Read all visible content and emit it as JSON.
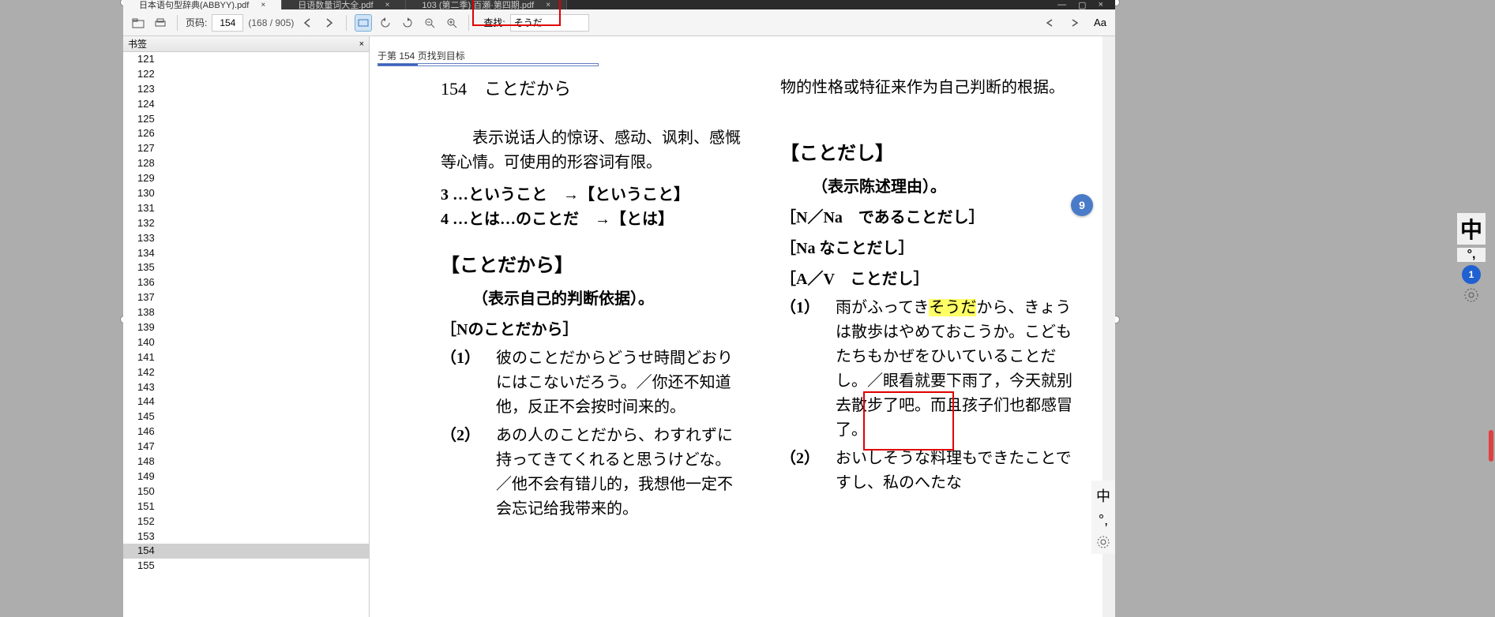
{
  "tabs": [
    {
      "title": "日本语句型辞典(ABBYY).pdf"
    },
    {
      "title": "日语数量词大全.pdf"
    },
    {
      "title": "103 (第二季) 百瀬·第四期.pdf"
    }
  ],
  "toolbar": {
    "page_label": "页码:",
    "page_value": "154",
    "page_count": "(168 / 905)",
    "search_label": "查找:",
    "search_value": "そうだ"
  },
  "sidebar": {
    "title": "书签",
    "items": [
      "121",
      "122",
      "123",
      "124",
      "125",
      "126",
      "127",
      "128",
      "129",
      "130",
      "131",
      "132",
      "133",
      "134",
      "135",
      "136",
      "137",
      "138",
      "139",
      "140",
      "141",
      "142",
      "143",
      "144",
      "145",
      "146",
      "147",
      "148",
      "149",
      "150",
      "151",
      "152",
      "153",
      "154",
      "155"
    ],
    "selected": "154"
  },
  "search_status": "于第 154 页找到目标",
  "page_badge": "9",
  "doc": {
    "heading": "154　ことだから",
    "left": {
      "p1": "　　表示说话人的惊讶、感动、讽刺、感慨等心情。可使用的形容词有限。",
      "l3": "3 …ということ　→【ということ】",
      "l4": "4 …とは…のことだ　→【とは】",
      "title": "【ことだから】",
      "subtitle": "（表示自己的判断依据）。",
      "pattern": "［Nのことだから］",
      "ex1_num": "（1）",
      "ex1": "彼のことだからどうせ時間どおりにはこないだろう。／你还不知道他，反正不会按时间来的。",
      "ex2_num": "（2）",
      "ex2": "あの人のことだから、わすれずに持ってきてくれると思うけどな。／他不会有错儿的，我想他一定不会忘记给我带来的。"
    },
    "right": {
      "p1": "物的性格或特征来作为自己判断的根据。",
      "title": "【ことだし】",
      "subtitle": "（表示陈述理由）。",
      "pat1": "［N／Na　であることだし］",
      "pat2": "［Na なことだし］",
      "pat3": "［A／V　ことだし］",
      "ex1_num": "（1）",
      "ex1a": "雨がふってき",
      "ex1_hl": "そうだ",
      "ex1b": "から、きょうは散歩はやめておこうか。こどもたちもかぜをひいていることだし。／眼看就要下雨了，今天就别去散步了吧。而且孩子们也都感冒了。",
      "ex2_num": "（2）",
      "ex2": "おいしそうな料理もできたことですし、私のへたな"
    }
  },
  "right_tools": {
    "zh": "中",
    "punct": "°,"
  },
  "ime": {
    "char": "中",
    "punct": "°,",
    "badge": "1"
  }
}
